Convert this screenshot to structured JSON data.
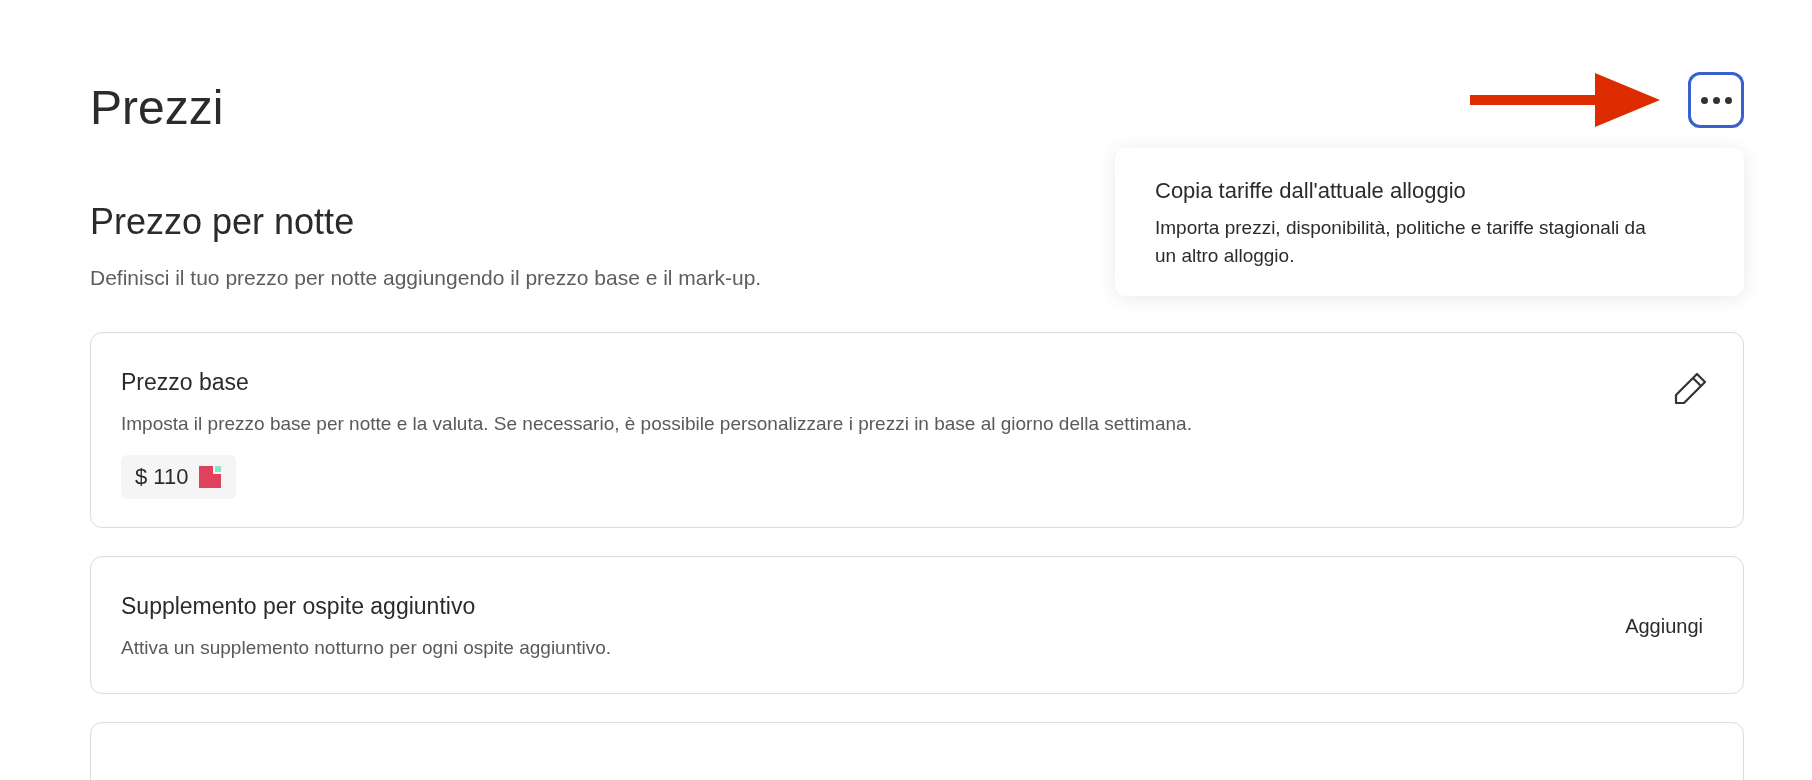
{
  "page": {
    "title": "Prezzi"
  },
  "menu_popover": {
    "title": "Copia tariffe dall'attuale alloggio",
    "description": "Importa prezzi, disponibilità, politiche e tariffe stagionali da un altro alloggio."
  },
  "section": {
    "title": "Prezzo per notte",
    "subtitle": "Definisci il tuo prezzo per notte aggiungendo il prezzo base e il mark-up."
  },
  "cards": [
    {
      "kind": "edit",
      "title": "Prezzo base",
      "description": "Imposta il prezzo base per notte e la valuta. Se necessario, è possibile personalizzare i prezzi in base al giorno della settimana.",
      "price": "$ 110"
    },
    {
      "kind": "add",
      "title": "Supplemento per ospite aggiuntivo",
      "description": "Attiva un supplemento notturno per ogni ospite aggiuntivo.",
      "action": "Aggiungi"
    },
    {
      "kind": "cut"
    }
  ]
}
